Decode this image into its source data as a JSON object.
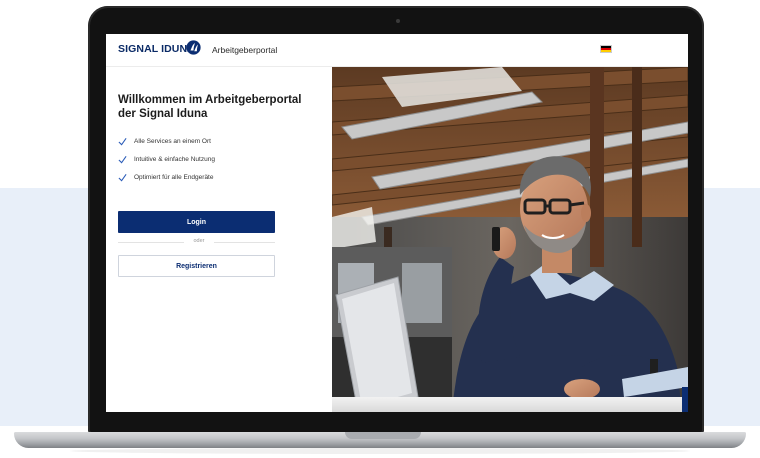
{
  "header": {
    "brand": "SIGNAL IDUNA",
    "app_name": "Arbeitgeberportal",
    "language_flag": "german-flag-icon"
  },
  "login_panel": {
    "title": "Willkommen im Arbeitgeberportal der Signal Iduna",
    "features": [
      "Alle Services an einem Ort",
      "Intuitive & einfache Nutzung",
      "Optimiert für alle Endgeräte"
    ],
    "login_label": "Login",
    "or_label": "oder",
    "register_label": "Registrieren"
  },
  "colors": {
    "brand_navy": "#0b2d72",
    "check_blue": "#2b5cb8",
    "background_band": "#e8eff9"
  }
}
